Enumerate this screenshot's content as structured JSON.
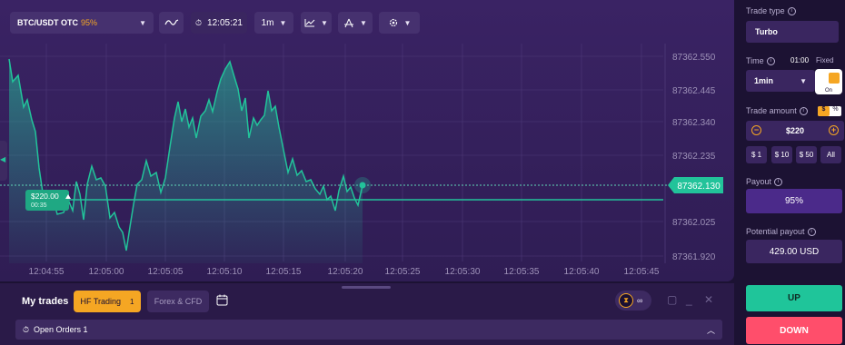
{
  "toolbar": {
    "asset": "BTC/USDT OTC",
    "asset_payout": "95%",
    "time": "12:05:21",
    "timeframe": "1m"
  },
  "chart": {
    "price_ticks": [
      "87362.550",
      "87362.445",
      "87362.340",
      "87362.235",
      "87362.025",
      "87361.920"
    ],
    "time_ticks": [
      "12:04:55",
      "12:05:00",
      "12:05:05",
      "12:05:10",
      "12:05:15",
      "12:05:20",
      "12:05:25",
      "12:05:30",
      "12:05:35",
      "12:05:40",
      "12:05:45"
    ],
    "current_price": "87362.130",
    "trade_amount": "$220.00",
    "trade_remaining": "00:35",
    "colors": {
      "line": "#22c39a",
      "grid": "#4e3a78"
    }
  },
  "bottom": {
    "my_trades": "My trades",
    "hf_trading": "HF Trading",
    "hf_count": "1",
    "forex_cfd": "Forex & CFD",
    "promo_value": "∞",
    "open_orders": "Open Orders 1"
  },
  "right": {
    "trade_type_label": "Trade type",
    "trade_type": "Turbo",
    "time_label": "Time",
    "time_countdown": "01:00",
    "fixed_label": "Fixed",
    "time_value": "1min",
    "toggle_on": "On",
    "amount_label": "Trade amount",
    "currency_a": "$",
    "currency_b": "%",
    "amount": "$220",
    "presets": [
      "$ 1",
      "$ 10",
      "$ 50",
      "All"
    ],
    "payout_label": "Payout",
    "payout": "95%",
    "potential_label": "Potential payout",
    "potential": "429.00 USD",
    "up": "UP",
    "down": "DOWN"
  }
}
